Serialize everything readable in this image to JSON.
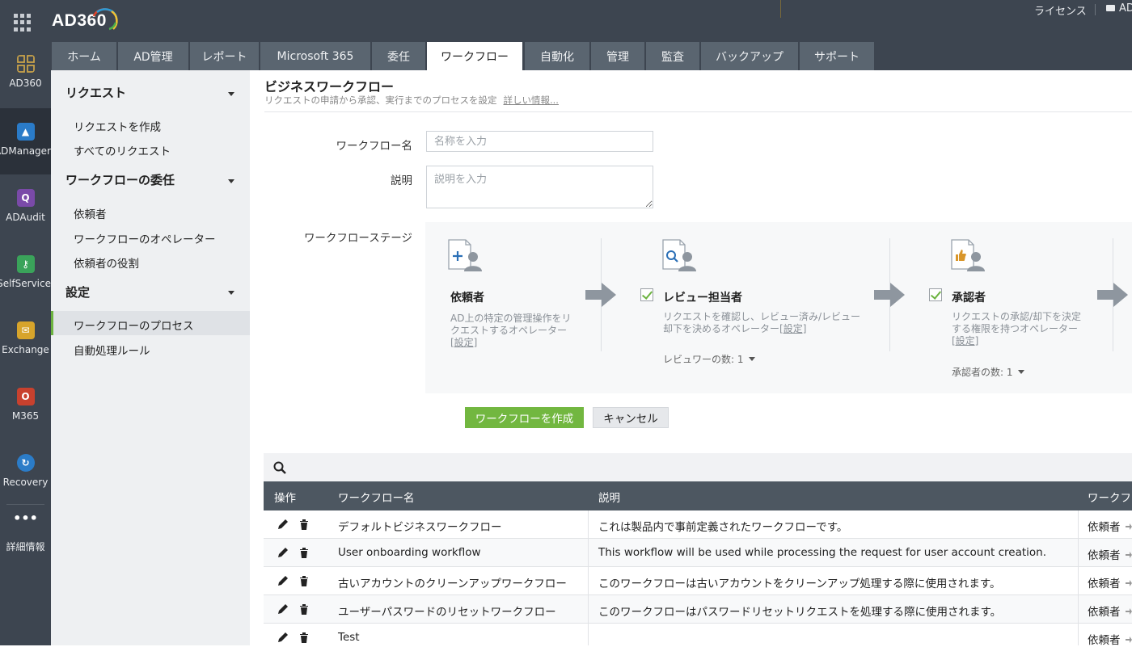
{
  "app": {
    "logo": "AD360",
    "license": "ライセンス",
    "folder_label": "AD"
  },
  "rail": [
    {
      "label": "AD360",
      "icon": "ad360-grid-icon",
      "color": "#c8a24a"
    },
    {
      "label": "ADManager",
      "icon": "admanager-icon",
      "color": "#2a7bc8"
    },
    {
      "label": "ADAudit",
      "icon": "adaudit-icon",
      "color": "#7a4aa8"
    },
    {
      "label": "SelfService",
      "icon": "selfservice-key-icon",
      "color": "#3aa35a"
    },
    {
      "label": "Exchange",
      "icon": "exchange-mail-icon",
      "color": "#d7a42b"
    },
    {
      "label": "M365",
      "icon": "m365-office-icon",
      "color": "#c8412e"
    },
    {
      "label": "Recovery",
      "icon": "recovery-icon",
      "color": "#2b7cc8"
    },
    {
      "label": "詳細情報",
      "icon": "more-dots-icon",
      "color": "#3d4550"
    }
  ],
  "tabs": [
    "ホーム",
    "AD管理",
    "レポート",
    "Microsoft 365",
    "委任",
    "ワークフロー",
    "自動化",
    "管理",
    "監査",
    "バックアップ",
    "サポート"
  ],
  "active_tab": "ワークフロー",
  "sidebar": {
    "sections": [
      {
        "title": "リクエスト",
        "items": [
          "リクエストを作成",
          "すべてのリクエスト"
        ]
      },
      {
        "title": "ワークフローの委任",
        "items": [
          "依頼者",
          "ワークフローのオペレーター",
          "依頼者の役割"
        ]
      },
      {
        "title": "設定",
        "items": [
          "ワークフローのプロセス",
          "自動処理ルール"
        ]
      }
    ],
    "active_item": "ワークフローのプロセス"
  },
  "main": {
    "title": "ビジネスワークフロー",
    "subtitle": "リクエストの申請から承認、実行までのプロセスを設定",
    "more_link": "詳しい情報...",
    "form": {
      "name_label": "ワークフロー名",
      "name_placeholder": "名称を入力",
      "desc_label": "説明",
      "desc_placeholder": "説明を入力",
      "stage_label": "ワークフローステージ"
    },
    "stages": [
      {
        "title": "依頼者",
        "desc": "AD上の特定の管理操作をリクエストするオペレーター",
        "config": "[設定]",
        "checked": false,
        "count": ""
      },
      {
        "title": "レビュー担当者",
        "desc": "リクエストを確認し、レビュー済み/レビュー却下を決めるオペレーター",
        "config": "[設定]",
        "checked": true,
        "count": "レビュワーの数: 1"
      },
      {
        "title": "承認者",
        "desc": "リクエストの承認/却下を決定する権限を持つオペレーター",
        "config": "[設定]",
        "checked": true,
        "count": "承認者の数: 1"
      }
    ],
    "create_button": "ワークフローを作成",
    "cancel_button": "キャンセル"
  },
  "table": {
    "columns": [
      "操作",
      "ワークフロー名",
      "説明",
      "ワークフ"
    ],
    "rows": [
      {
        "name": "デフォルトビジネスワークフロー",
        "desc": "これは製品内で事前定義されたワークフローです。",
        "stage": "依頼者"
      },
      {
        "name": "User onboarding workflow",
        "desc": "This workflow will be used while processing the request for user account creation.",
        "stage": "依頼者"
      },
      {
        "name": "古いアカウントのクリーンアップワークフロー",
        "desc": "このワークフローは古いアカウントをクリーンアップ処理する際に使用されます。",
        "stage": "依頼者"
      },
      {
        "name": "ユーザーパスワードのリセットワークフロー",
        "desc": "このワークフローはパスワードリセットリクエストを処理する際に使用されます。",
        "stage": "依頼者"
      },
      {
        "name": "Test",
        "desc": "",
        "stage": "依頼者"
      }
    ]
  },
  "colors": {
    "topbar": "#3d4550",
    "accent_green": "#72b740",
    "table_header": "#4d5761"
  }
}
